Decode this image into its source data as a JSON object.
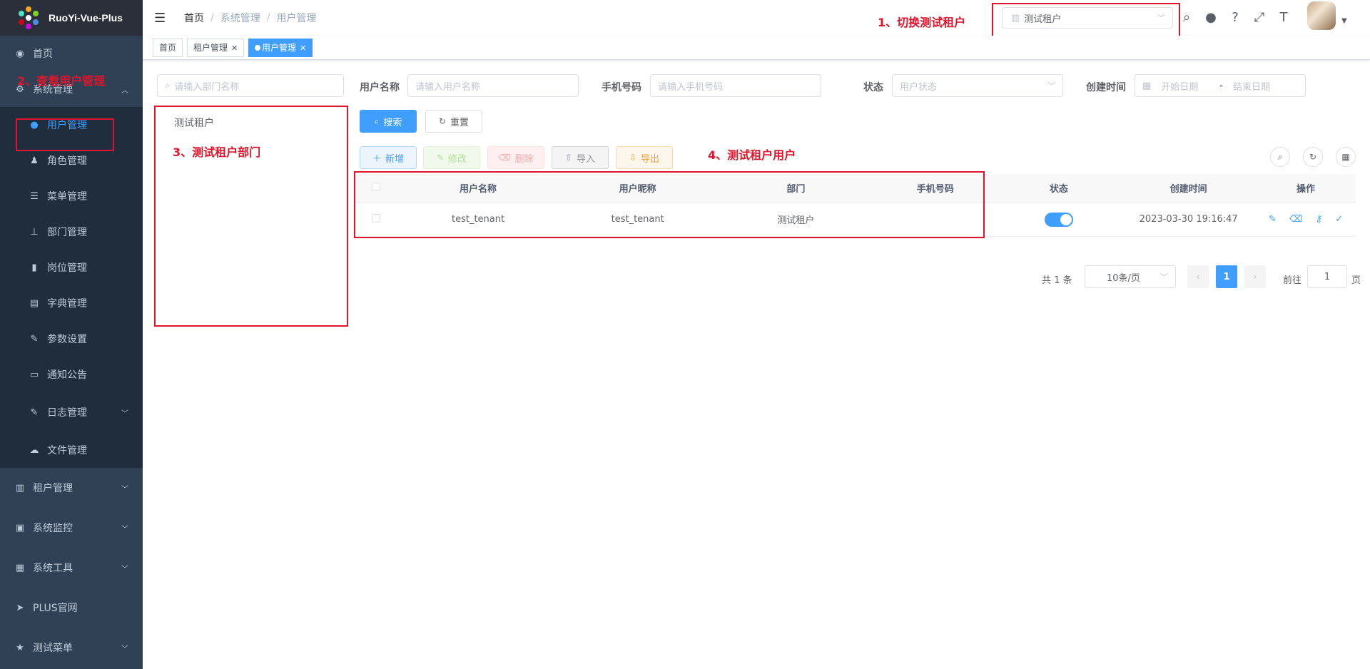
{
  "app": {
    "title": "RuoYi-Vue-Plus"
  },
  "sidebar": {
    "home": "首页",
    "system": "系统管理",
    "sub": [
      {
        "label": "用户管理",
        "icon": "user-icon"
      },
      {
        "label": "角色管理",
        "icon": "role-icon"
      },
      {
        "label": "菜单管理",
        "icon": "menu-tree-icon"
      },
      {
        "label": "部门管理",
        "icon": "org-tree-icon"
      },
      {
        "label": "岗位管理",
        "icon": "post-icon"
      },
      {
        "label": "字典管理",
        "icon": "dict-icon"
      },
      {
        "label": "参数设置",
        "icon": "edit-icon"
      },
      {
        "label": "通知公告",
        "icon": "message-icon"
      },
      {
        "label": "日志管理",
        "icon": "log-icon"
      },
      {
        "label": "文件管理",
        "icon": "upload-icon"
      }
    ],
    "tenant": "租户管理",
    "monitor": "系统监控",
    "tools": "系统工具",
    "plus": "PLUS官网",
    "test": "测试菜单"
  },
  "navbar": {
    "breadcrumb": [
      "首页",
      "系统管理",
      "用户管理"
    ],
    "tenant_value": "测试租户"
  },
  "tags": [
    "首页",
    "租户管理",
    "用户管理"
  ],
  "annotations": {
    "a1": "1、切换测试租户",
    "a2": "2、查看用户管理",
    "a3": "3、测试租户部门",
    "a4": "4、测试租户用户"
  },
  "dept": {
    "search_placeholder": "请输入部门名称",
    "tree_root": "测试租户"
  },
  "filters": {
    "username_label": "用户名称",
    "username_placeholder": "请输入用户名称",
    "phone_label": "手机号码",
    "phone_placeholder": "请输入手机号码",
    "status_label": "状态",
    "status_placeholder": "用户状态",
    "created_label": "创建时间",
    "start_placeholder": "开始日期",
    "range_sep": "-",
    "end_placeholder": "结束日期"
  },
  "buttons": {
    "search": "搜索",
    "reset": "重置",
    "add": "新增",
    "edit": "修改",
    "delete": "删除",
    "import": "导入",
    "export": "导出"
  },
  "table": {
    "headers": [
      "用户名称",
      "用户昵称",
      "部门",
      "手机号码",
      "状态",
      "创建时间",
      "操作"
    ],
    "rows": [
      {
        "username": "test_tenant",
        "nickname": "test_tenant",
        "dept": "测试租户",
        "phone": "",
        "status": true,
        "created": "2023-03-30 19:16:47"
      }
    ]
  },
  "pagination": {
    "total": "共 1 条",
    "size": "10条/页",
    "current": "1",
    "goto": "前往",
    "goto_value": "1",
    "page": "页"
  },
  "colors": {
    "primary": "#409eff",
    "sidebar": "#304156",
    "annotation": "#e0152b"
  }
}
